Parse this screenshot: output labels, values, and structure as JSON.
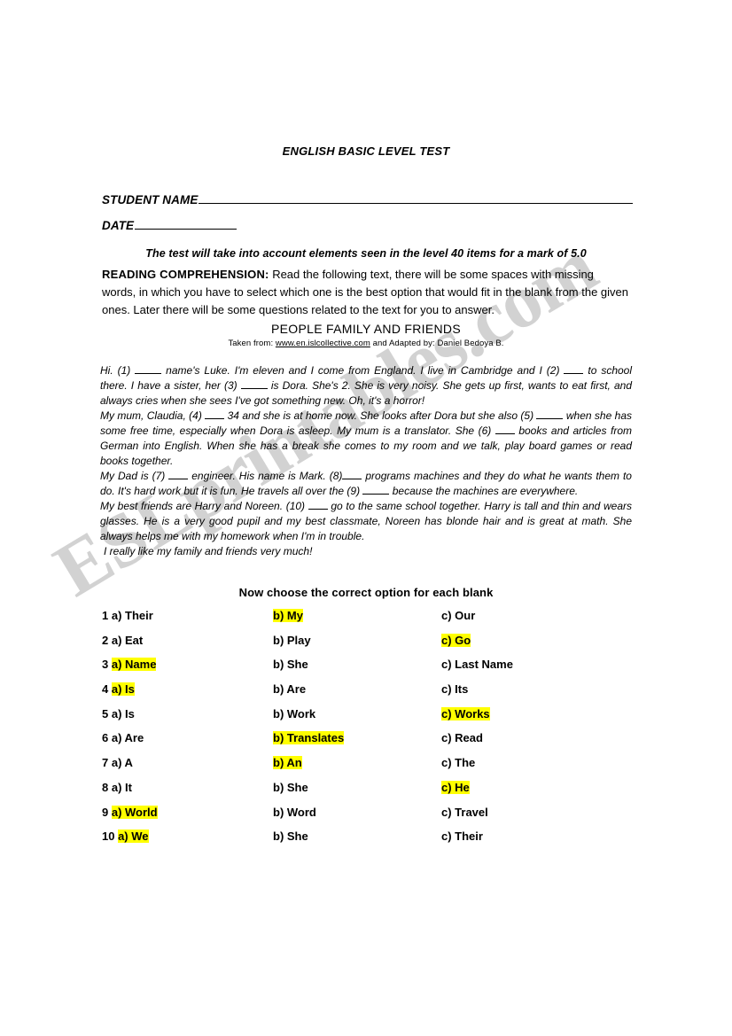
{
  "watermark": {
    "text": "ESLprintables.com",
    "color": "#d2d2d2"
  },
  "document": {
    "title": "ENGLISH BASIC LEVEL TEST",
    "fields": {
      "student_name_label": "STUDENT NAME",
      "date_label": "DATE"
    },
    "subtitle": "The test will take into account elements seen in the level 40 items for a mark of 5.0",
    "instructions": {
      "lead": "READING COMPREHENSION:",
      "body": " Read the following text, there will be some spaces with missing words, in which you have to select which one is the best option that would fit in the blank from the given ones. Later there will be some questions related to the text for you to answer."
    },
    "passage_title": "PEOPLE FAMILY AND FRIENDS",
    "source": {
      "prefix": "Taken from: ",
      "link": "www.en.islcollective.com",
      "suffix": " and Adapted by: Daniel Bedoya B."
    },
    "passage": {
      "p1_a": "Hi. (1) ",
      "p1_b": " name's Luke. I'm eleven and I come from England. I live in Cambridge and I (2) ",
      "p1_c": " to school there. I have a sister, her (3) ",
      "p1_d": " is Dora. She's 2. She is very noisy. She gets up first, wants to eat first, and always cries when she sees I've got something new. Oh, it's a horror!",
      "p2_a": "My mum, Claudia, (4) ",
      "p2_b": " 34 and she is at home now. She looks after Dora but she also (5) ",
      "p2_c": " when she has some free time, especially when Dora is asleep. My mum is a translator. She (6) ",
      "p2_d": " books and articles from German into English. When she has a break she comes to my room and we talk, play board games or read books together.",
      "p3_a": "My Dad is (7) ",
      "p3_b": " engineer. His name is Mark. (8)",
      "p3_c": " programs machines and they do what he wants them to do. It's hard work but it is fun. He travels all over the (9) ",
      "p3_d": " because the machines are everywhere.",
      "p4_a": "My best friends are Harry and Noreen. (10) ",
      "p4_b": " go to the same school together. Harry is tall and thin and wears glasses. He is a very good pupil and my best classmate, Noreen has blonde hair and is great at math. She always helps me with my homework when I'm in trouble.",
      "p5": " I really like my family and friends very much!"
    },
    "choose_header": "Now choose the correct option for each blank",
    "answers": [
      {
        "num": "1",
        "a_letter": "a)",
        "a_text": "Their",
        "a_hl": false,
        "b_letter": "b)",
        "b_text": "My",
        "b_hl": true,
        "c_letter": "c)",
        "c_text": "Our",
        "c_hl": false
      },
      {
        "num": "2",
        "a_letter": "a)",
        "a_text": "Eat",
        "a_hl": false,
        "b_letter": "b)",
        "b_text": "Play",
        "b_hl": false,
        "c_letter": "c)",
        "c_text": "Go",
        "c_hl": true
      },
      {
        "num": "3",
        "a_letter": "a)",
        "a_text": "Name",
        "a_hl": true,
        "b_letter": "b)",
        "b_text": "She",
        "b_hl": false,
        "c_letter": "c)",
        "c_text": "Last Name",
        "c_hl": false
      },
      {
        "num": "4",
        "a_letter": "a)",
        "a_text": "Is",
        "a_hl": true,
        "b_letter": "b)",
        "b_text": "Are",
        "b_hl": false,
        "c_letter": "c)",
        "c_text": "Its",
        "c_hl": false
      },
      {
        "num": "5",
        "a_letter": "a)",
        "a_text": "Is",
        "a_hl": false,
        "b_letter": "b)",
        "b_text": "Work",
        "b_hl": false,
        "c_letter": "c)",
        "c_text": "Works",
        "c_hl": true
      },
      {
        "num": "6",
        "a_letter": "a)",
        "a_text": "Are",
        "a_hl": false,
        "b_letter": "b)",
        "b_text": "Translates",
        "b_hl": true,
        "c_letter": "c)",
        "c_text": "Read",
        "c_hl": false
      },
      {
        "num": "7",
        "a_letter": "a)",
        "a_text": "A",
        "a_hl": false,
        "b_letter": "b)",
        "b_text": "An",
        "b_hl": true,
        "c_letter": "c)",
        "c_text": "The",
        "c_hl": false
      },
      {
        "num": "8",
        "a_letter": "a)",
        "a_text": "It",
        "a_hl": false,
        "b_letter": "b)",
        "b_text": "She",
        "b_hl": false,
        "c_letter": "c)",
        "c_text": "He",
        "c_hl": true
      },
      {
        "num": "9",
        "a_letter": "a)",
        "a_text": "World",
        "a_hl": true,
        "b_letter": "b)",
        "b_text": "Word",
        "b_hl": false,
        "c_letter": "c)",
        "c_text": "Travel",
        "c_hl": false
      },
      {
        "num": "10",
        "a_letter": "a)",
        "a_text": "We",
        "a_hl": true,
        "b_letter": "b)",
        "b_text": "She",
        "b_hl": false,
        "c_letter": "c)",
        "c_text": "Their",
        "c_hl": false
      }
    ]
  }
}
